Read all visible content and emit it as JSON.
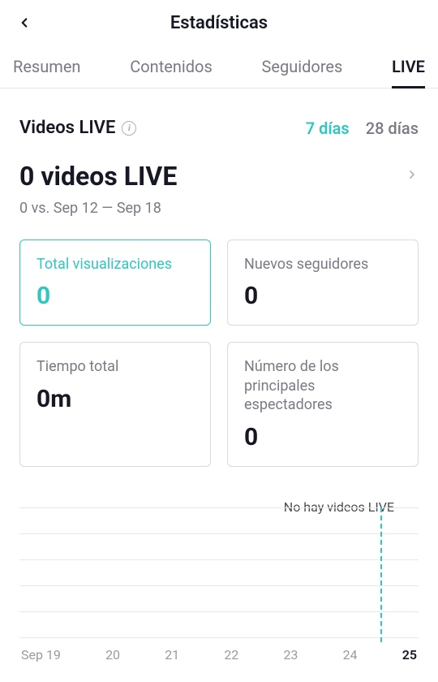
{
  "header": {
    "title": "Estadísticas"
  },
  "tabs": [
    {
      "label": "Resumen",
      "active": false
    },
    {
      "label": "Contenidos",
      "active": false
    },
    {
      "label": "Seguidores",
      "active": false
    },
    {
      "label": "LIVE",
      "active": true
    }
  ],
  "section": {
    "title": "Videos LIVE",
    "range": {
      "opt7": "7 días",
      "opt28": "28 días",
      "active": "7"
    },
    "summary": {
      "headline": "0 videos LIVE",
      "sub": "0 vs. Sep 12 — Sep 18"
    }
  },
  "cards": [
    {
      "label": "Total visualizaciones",
      "value": "0",
      "active": true
    },
    {
      "label": "Nuevos seguidores",
      "value": "0",
      "active": false
    },
    {
      "label": "Tiempo total",
      "value": "0m",
      "active": false
    },
    {
      "label": "Número de los principales espectadores",
      "value": "0",
      "active": false
    }
  ],
  "chart_data": {
    "type": "line",
    "title": "",
    "xlabel": "",
    "ylabel": "",
    "empty_message": "No hay videos LIVE",
    "categories": [
      "Sep 19",
      "20",
      "21",
      "22",
      "23",
      "24",
      "25"
    ],
    "values": [
      0,
      0,
      0,
      0,
      0,
      0,
      0
    ],
    "highlight_index": 6,
    "ylim": [
      0,
      0
    ]
  }
}
